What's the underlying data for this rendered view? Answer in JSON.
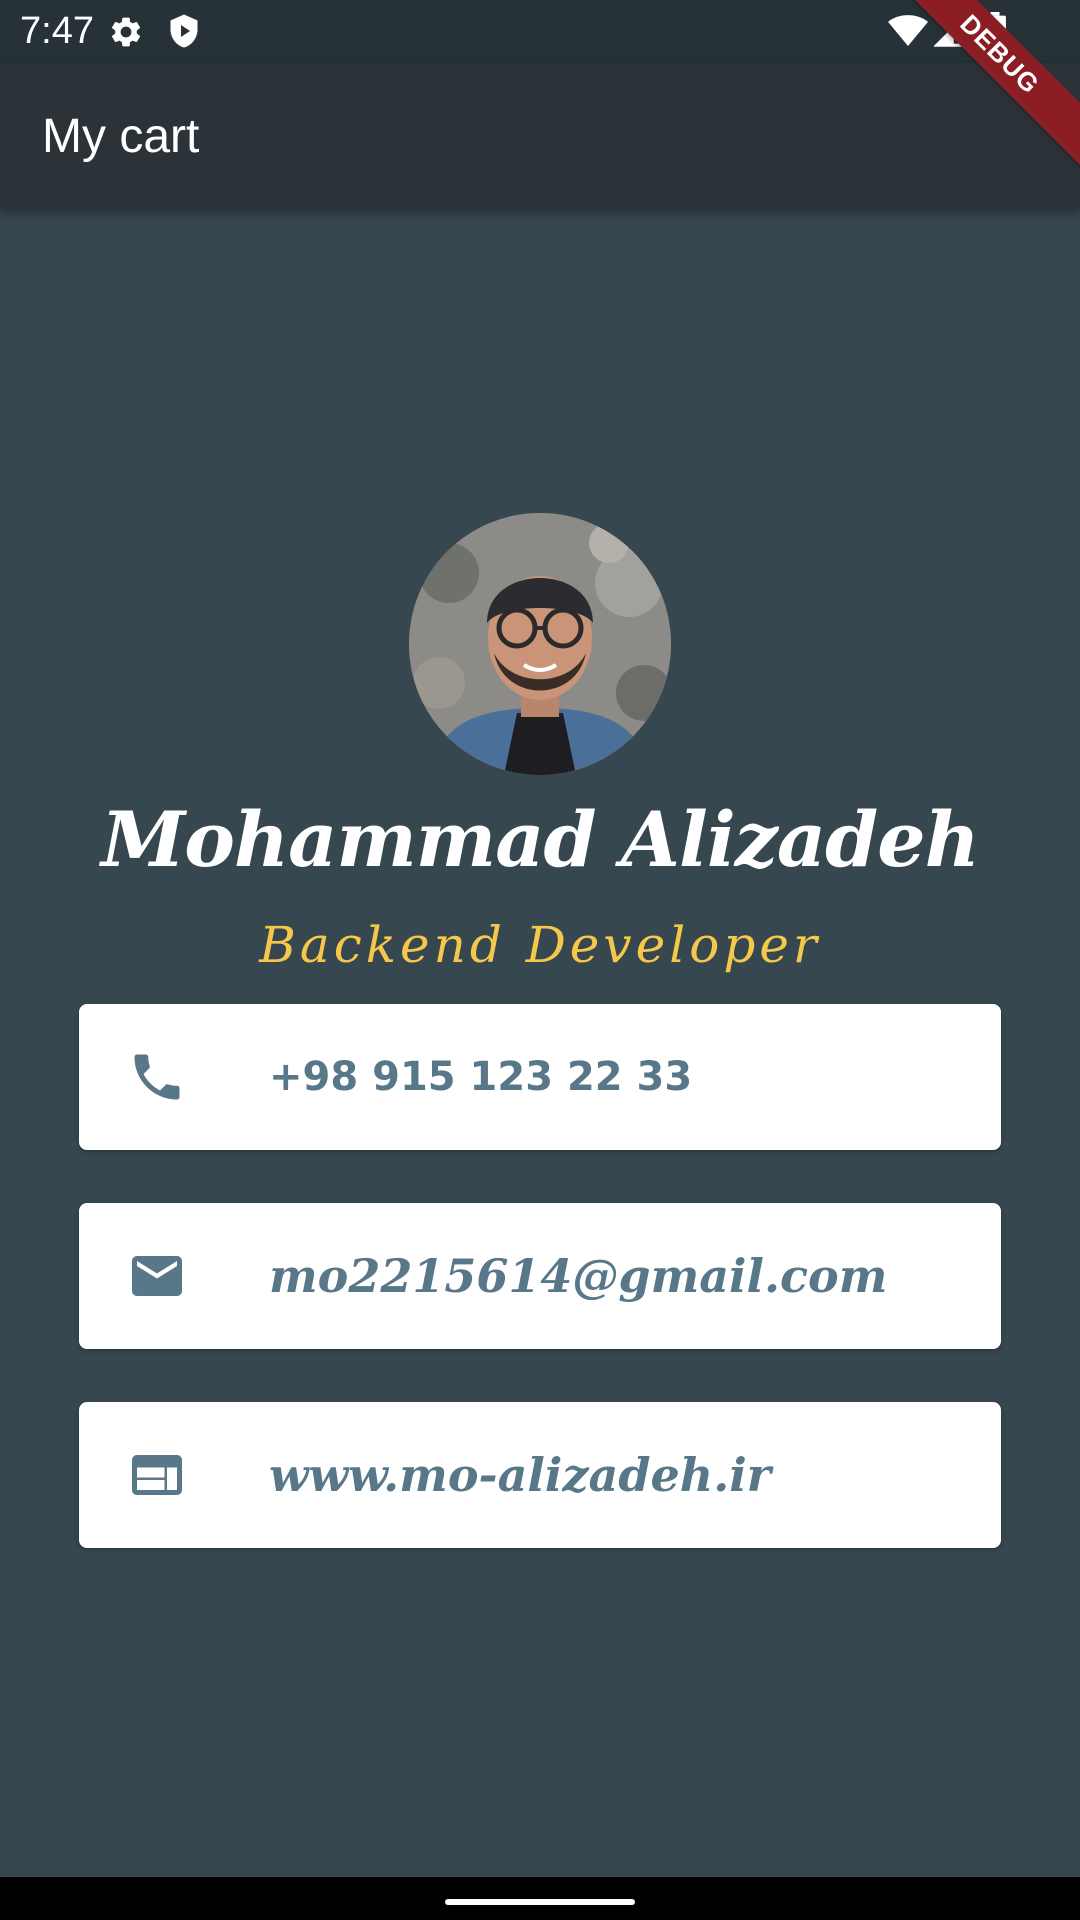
{
  "status_bar": {
    "time": "7:47",
    "icons": [
      "gear-icon",
      "shield-play-icon",
      "wifi-icon",
      "cell-signal-icon",
      "battery-icon"
    ]
  },
  "app_bar": {
    "title": "My cart"
  },
  "debug_banner": {
    "label": "DEBUG"
  },
  "profile": {
    "name": "Mohammad Alizadeh",
    "title": "Backend Developer"
  },
  "contacts": [
    {
      "icon": "phone-icon",
      "text": "+98 915 123 22 33"
    },
    {
      "icon": "mail-icon",
      "text": "mo2215614@gmail.com"
    },
    {
      "icon": "web-icon",
      "text": "www.mo-alizadeh.ir"
    }
  ],
  "colors": {
    "background": "#37474f",
    "app_bar": "#2b3338",
    "status_bar": "#263238",
    "accent_title": "#f5c84b",
    "card_text": "#587789",
    "debug_banner": "#8b1e24"
  }
}
